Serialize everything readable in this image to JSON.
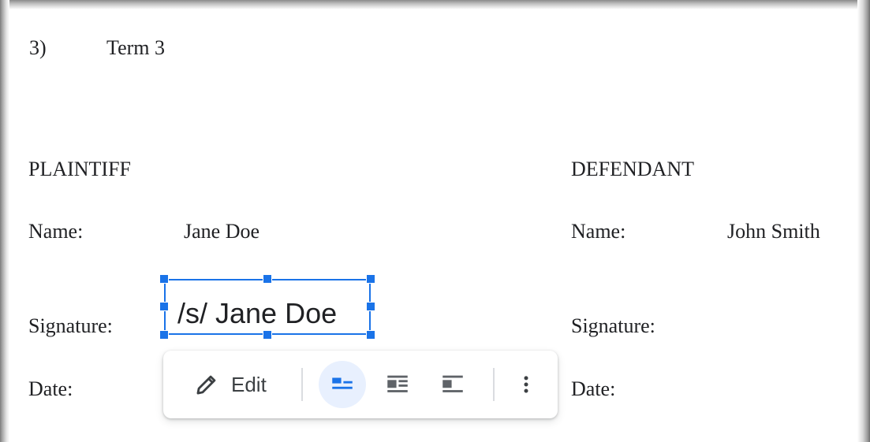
{
  "document": {
    "term_number": "3)",
    "term_title": "Term 3",
    "plaintiff": {
      "heading": "PLAINTIFF",
      "name_label": "Name:",
      "name_value": "Jane Doe",
      "signature_label": "Signature:",
      "date_label": "Date:"
    },
    "defendant": {
      "heading": "DEFENDANT",
      "name_label": "Name:",
      "name_value": "John Smith",
      "signature_label": "Signature:",
      "date_label": "Date:"
    }
  },
  "signature_drawing": {
    "text": "/s/ Jane Doe",
    "selected": true
  },
  "image_toolbar": {
    "edit_label": "Edit",
    "edit_icon": "pencil-icon",
    "buttons": [
      {
        "icon": "inline-with-text-icon",
        "active": true
      },
      {
        "icon": "wrap-text-icon",
        "active": false
      },
      {
        "icon": "break-text-icon",
        "active": false
      },
      {
        "icon": "more-options-icon",
        "active": false
      }
    ]
  },
  "colors": {
    "selection": "#1a73e8",
    "active_button_bg": "#e8f0fe",
    "text": "#202124",
    "icon": "#5f6368"
  }
}
